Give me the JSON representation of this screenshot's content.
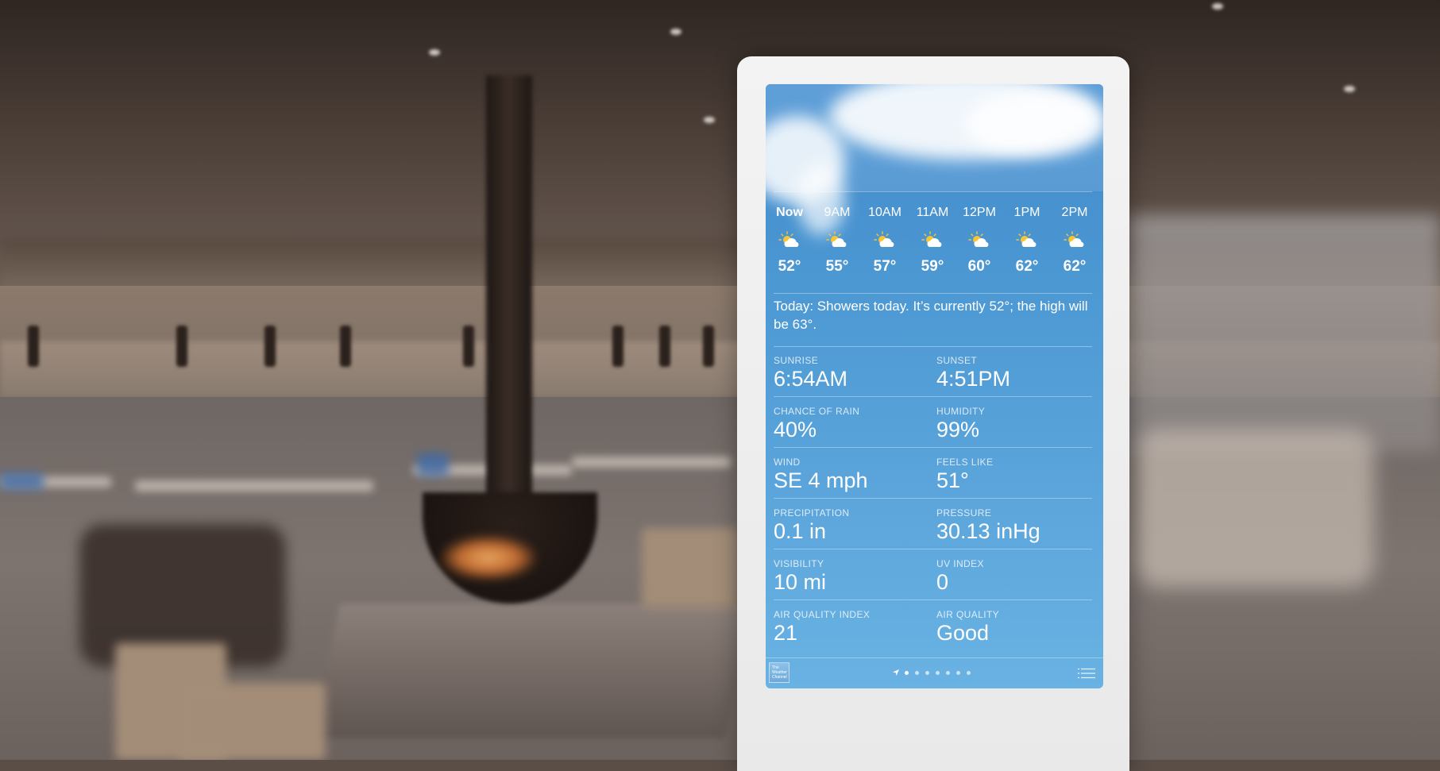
{
  "hourly": [
    {
      "time": "Now",
      "temp": "52°",
      "icon": "partly-cloudy-icon"
    },
    {
      "time": "9AM",
      "temp": "55°",
      "icon": "partly-cloudy-icon"
    },
    {
      "time": "10AM",
      "temp": "57°",
      "icon": "partly-cloudy-icon"
    },
    {
      "time": "11AM",
      "temp": "59°",
      "icon": "partly-cloudy-icon"
    },
    {
      "time": "12PM",
      "temp": "60°",
      "icon": "partly-cloudy-icon"
    },
    {
      "time": "1PM",
      "temp": "62°",
      "icon": "partly-cloudy-icon"
    },
    {
      "time": "2PM",
      "temp": "62°",
      "icon": "partly-cloudy-icon"
    }
  ],
  "summary": "Today: Showers today. It’s currently 52°; the high will be 63°.",
  "details": [
    [
      {
        "label": "SUNRISE",
        "value": "6:54AM"
      },
      {
        "label": "SUNSET",
        "value": "4:51PM"
      }
    ],
    [
      {
        "label": "CHANCE OF RAIN",
        "value": "40%"
      },
      {
        "label": "HUMIDITY",
        "value": "99%"
      }
    ],
    [
      {
        "label": "WIND",
        "value": "SE 4 mph"
      },
      {
        "label": "FEELS LIKE",
        "value": "51°"
      }
    ],
    [
      {
        "label": "PRECIPITATION",
        "value": "0.1 in"
      },
      {
        "label": "PRESSURE",
        "value": "30.13 inHg"
      }
    ],
    [
      {
        "label": "VISIBILITY",
        "value": "10 mi"
      },
      {
        "label": "UV INDEX",
        "value": "0"
      }
    ],
    [
      {
        "label": "AIR QUALITY INDEX",
        "value": "21"
      },
      {
        "label": "AIR QUALITY",
        "value": "Good"
      }
    ]
  ],
  "footer": {
    "logo_text": "The Weather Channel",
    "page_count": 8,
    "active_page": 0,
    "icons": {
      "location": "location-arrow-icon",
      "list": "list-icon"
    }
  },
  "colors": {
    "screen_top": "#3f87c9",
    "screen_bottom": "#69b2e3",
    "sun": "#f6c534",
    "cloud": "#ffffff"
  }
}
